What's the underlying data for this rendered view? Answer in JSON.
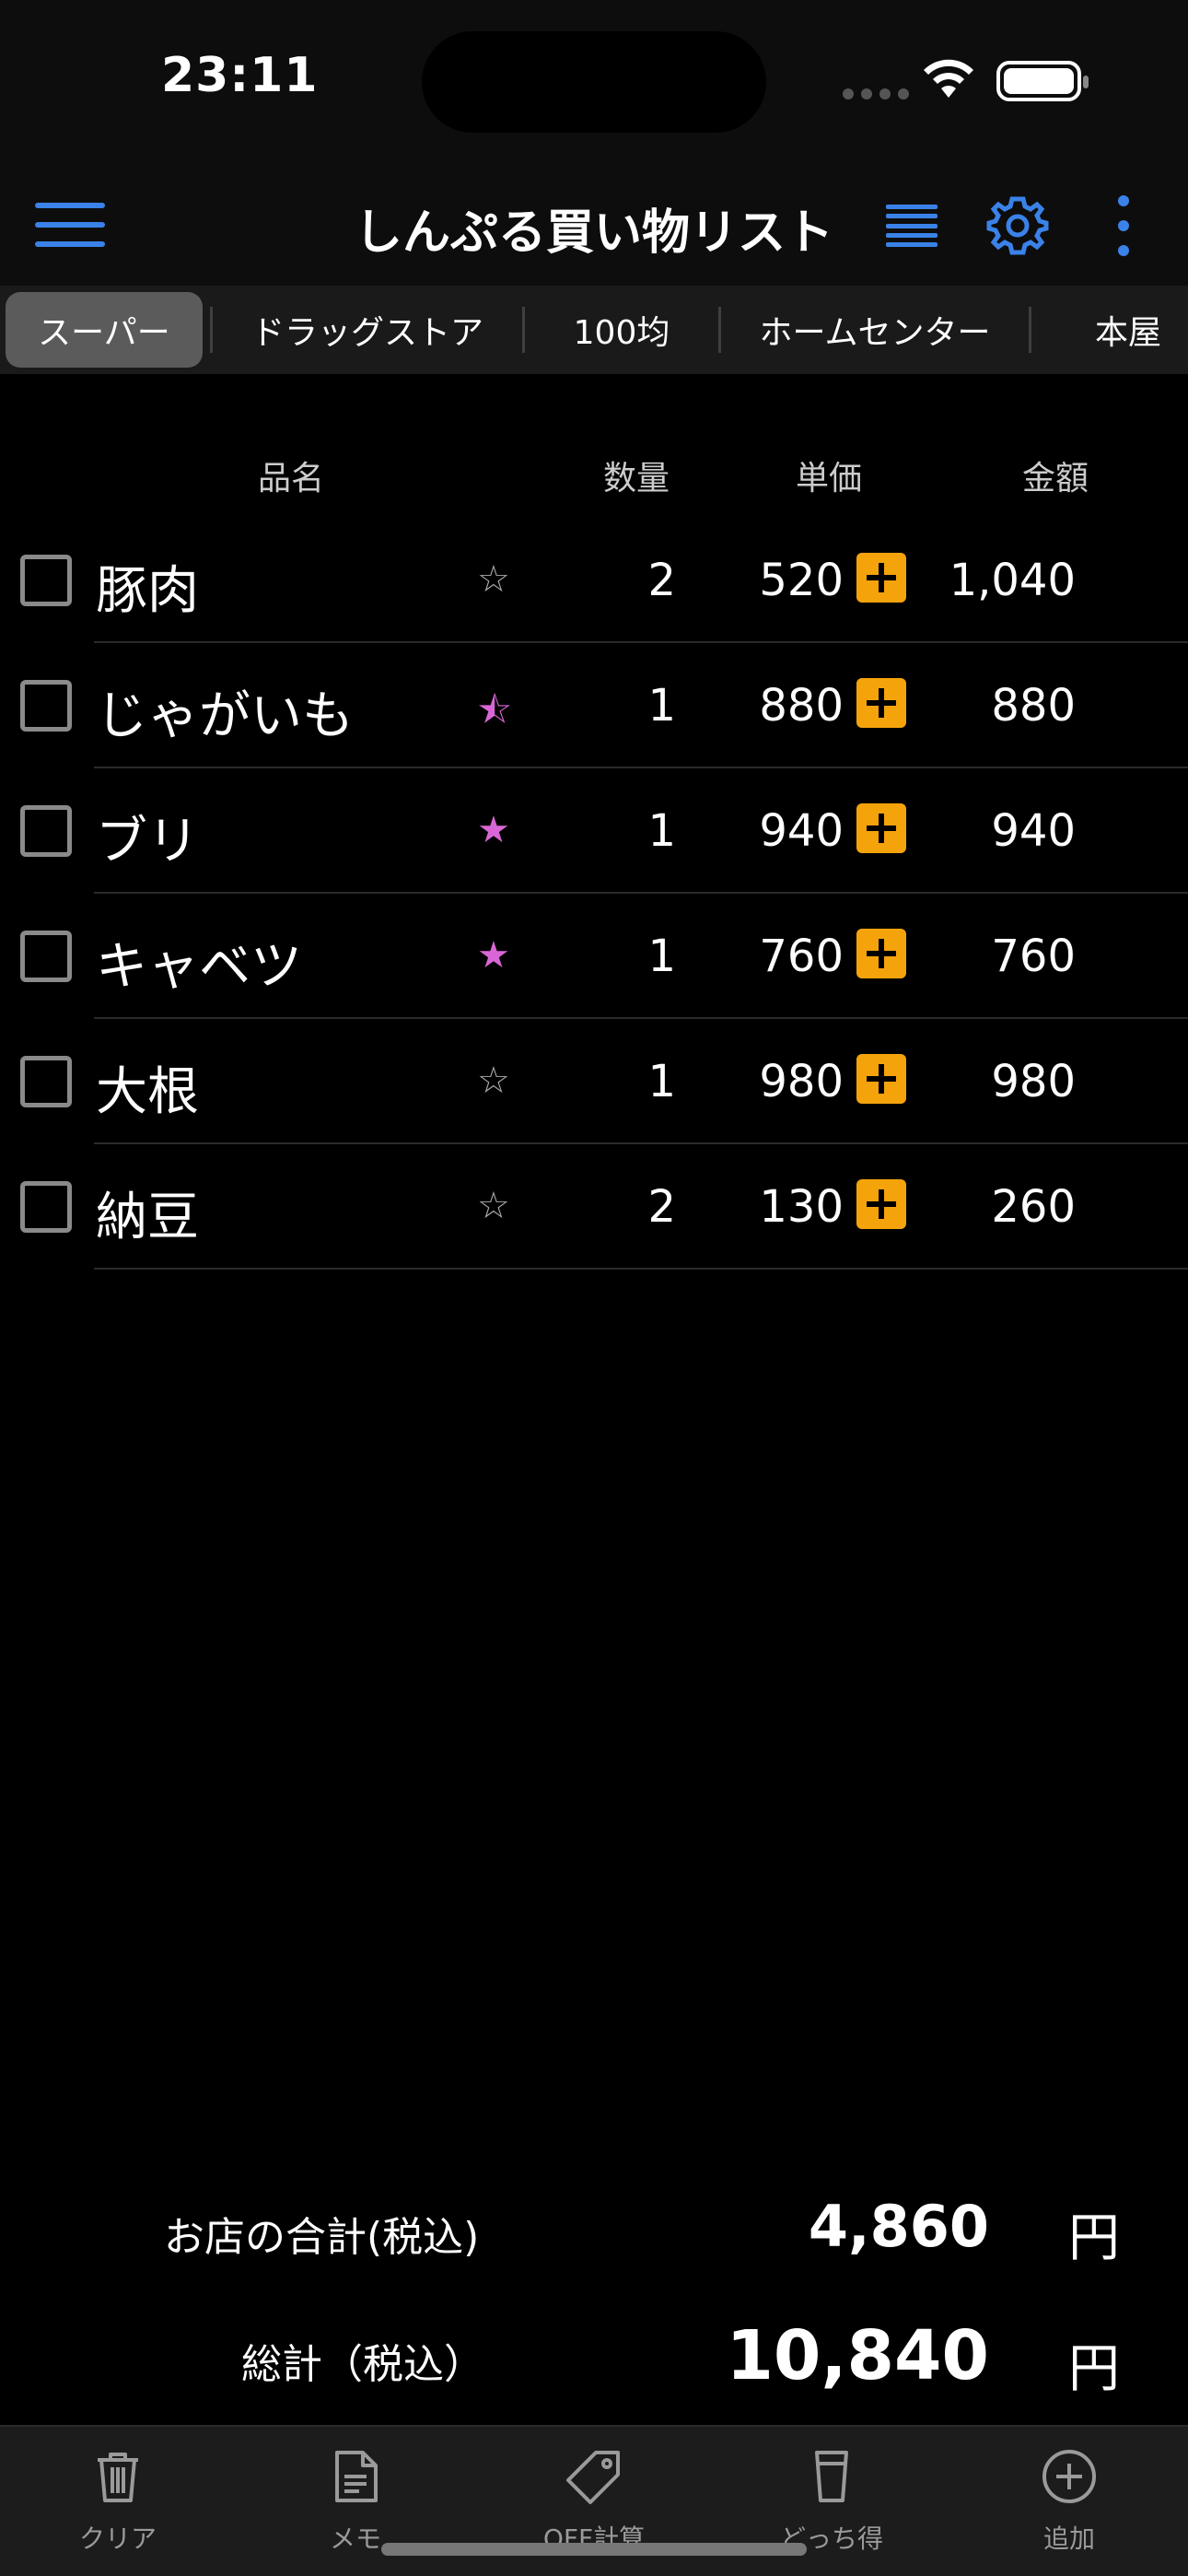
{
  "status_bar": {
    "time": "23:11"
  },
  "header": {
    "title": "しんぷる買い物リスト"
  },
  "tabs": [
    {
      "label": "スーパー",
      "active": true
    },
    {
      "label": "ドラッグストア",
      "active": false
    },
    {
      "label": "100均",
      "active": false
    },
    {
      "label": "ホームセンター",
      "active": false
    },
    {
      "label": "本屋",
      "active": false
    }
  ],
  "table": {
    "headers": {
      "name": "品名",
      "qty": "数量",
      "price": "単価",
      "amount": "金額"
    },
    "rows": [
      {
        "name": "豚肉",
        "star": "empty",
        "qty": "2",
        "price": "520",
        "amount": "1,040"
      },
      {
        "name": "じゃがいも",
        "star": "half",
        "qty": "1",
        "price": "880",
        "amount": "880"
      },
      {
        "name": "ブリ",
        "star": "full",
        "qty": "1",
        "price": "940",
        "amount": "940"
      },
      {
        "name": "キャベツ",
        "star": "full",
        "qty": "1",
        "price": "760",
        "amount": "760"
      },
      {
        "name": "大根",
        "star": "empty",
        "qty": "1",
        "price": "980",
        "amount": "980"
      },
      {
        "name": "納豆",
        "star": "empty",
        "qty": "2",
        "price": "130",
        "amount": "260"
      }
    ]
  },
  "totals": {
    "store_label": "お店の合計(税込)",
    "store_value": "4,860",
    "grand_label": "総計（税込）",
    "grand_value": "10,840",
    "currency": "円"
  },
  "bottom_bar": [
    {
      "label": "クリア",
      "icon": "trash-icon"
    },
    {
      "label": "メモ",
      "icon": "memo-icon"
    },
    {
      "label": "OFF計算",
      "icon": "tag-icon"
    },
    {
      "label": "どっち得",
      "icon": "glass-icon"
    },
    {
      "label": "追加",
      "icon": "plus-circle-icon"
    }
  ],
  "colors": {
    "accent_blue": "#3a82e8",
    "star_pink": "#d966d6",
    "plus_orange": "#f5a30b"
  }
}
